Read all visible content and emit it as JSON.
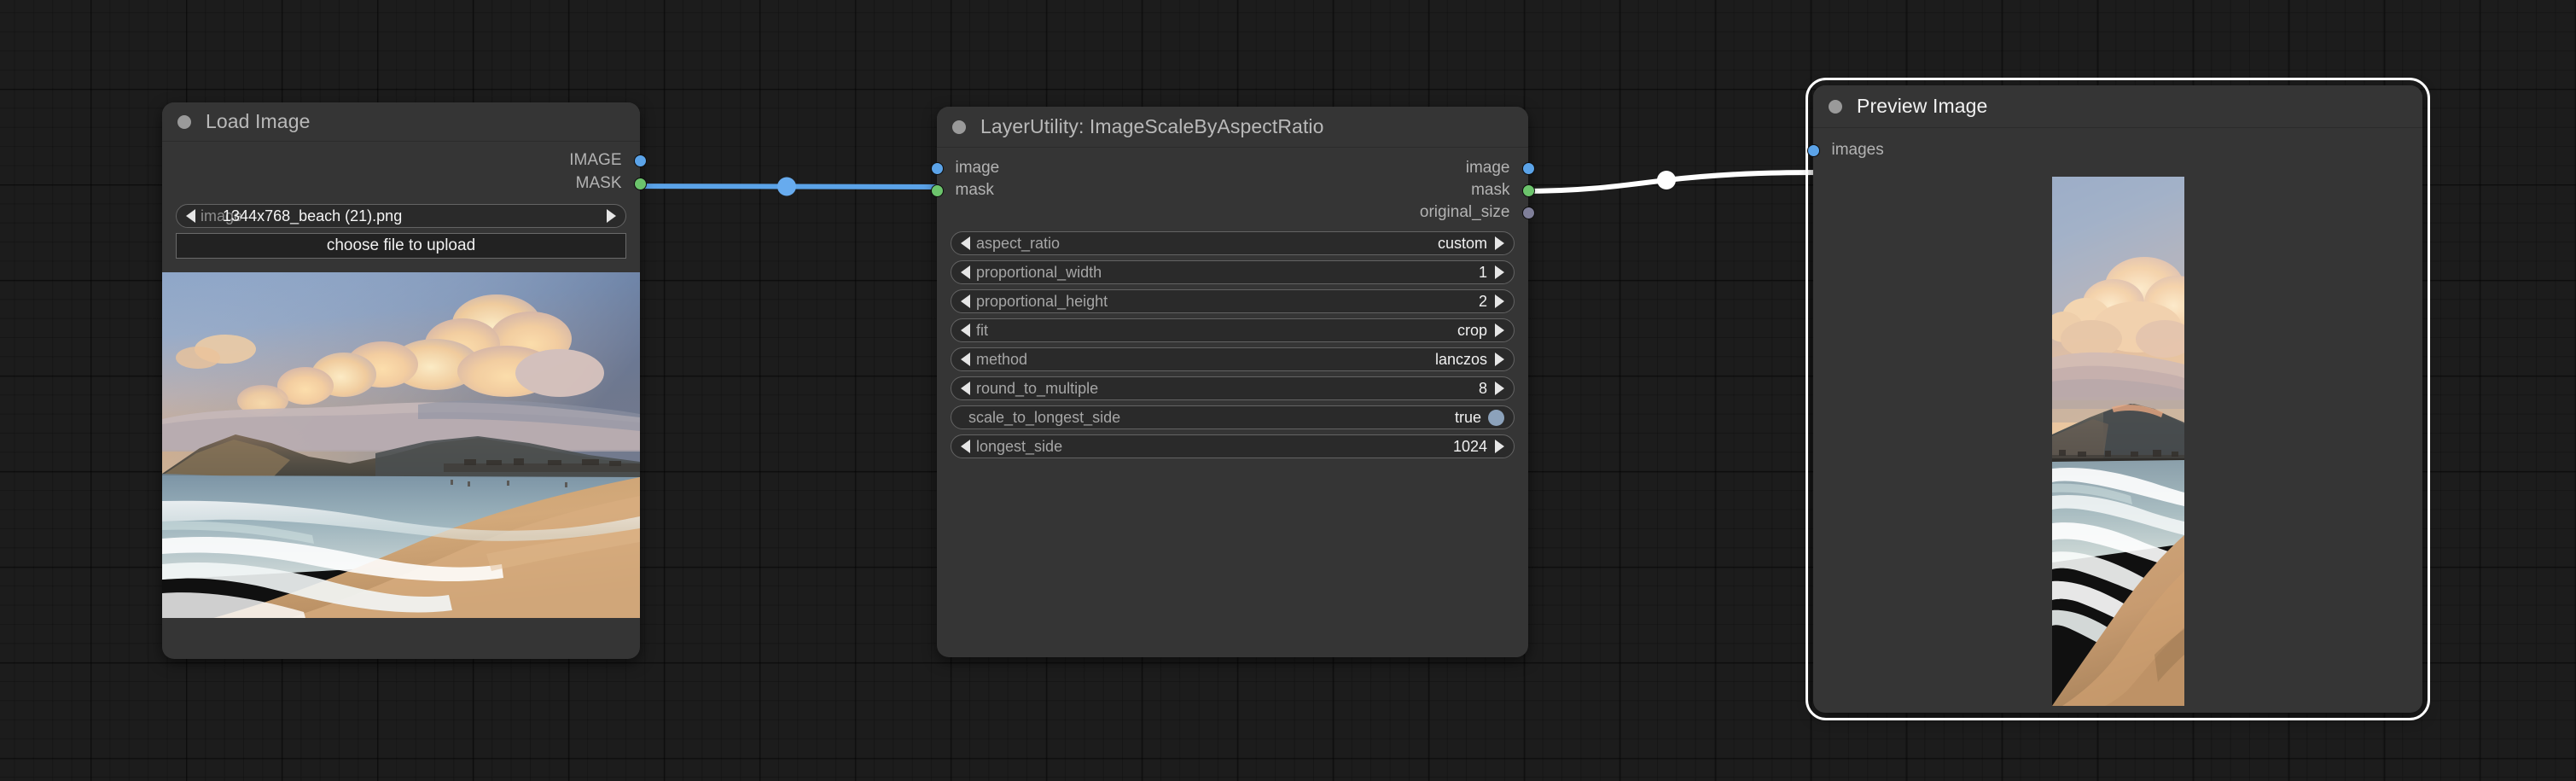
{
  "app": {
    "kind": "node-graph-editor",
    "background_color": "#1c1c1c",
    "grid_color": "#141414"
  },
  "colors": {
    "node_bg": "#353535",
    "node_title_bg": "#353535",
    "widget_bg": "#2a2a2a",
    "slot_image": "#5ba3e8",
    "slot_mask": "#6cc46c",
    "slot_generic": "#7f7f99",
    "link_image": "#5ba3e8",
    "link_selected": "#ffffff",
    "selection_ring": "#ffffff",
    "toggle_on": "#8ca2bb"
  },
  "nodes": [
    {
      "id": "load-image",
      "title": "Load Image",
      "selected": false,
      "outputs": [
        {
          "label": "IMAGE",
          "color": "#5ba3e8"
        },
        {
          "label": "MASK",
          "color": "#6cc46c"
        }
      ],
      "inputs": [],
      "widgets": [
        {
          "type": "combo-overlap",
          "label": "image",
          "value": "1344x768_beach (21).png"
        }
      ],
      "button": {
        "label": "choose file to upload"
      },
      "preview": {
        "alt": "beach-sunset-landscape-thumbnail"
      }
    },
    {
      "id": "image-scale-by-aspect-ratio",
      "title": "LayerUtility: ImageScaleByAspectRatio",
      "selected": false,
      "inputs": [
        {
          "label": "image",
          "color": "#5ba3e8"
        },
        {
          "label": "mask",
          "color": "#6cc46c"
        }
      ],
      "outputs": [
        {
          "label": "image",
          "color": "#5ba3e8"
        },
        {
          "label": "mask",
          "color": "#6cc46c"
        },
        {
          "label": "original_size",
          "color": "#7f7f99"
        }
      ],
      "widgets": [
        {
          "type": "combo",
          "label": "aspect_ratio",
          "value": "custom"
        },
        {
          "type": "number",
          "label": "proportional_width",
          "value": "1"
        },
        {
          "type": "number",
          "label": "proportional_height",
          "value": "2"
        },
        {
          "type": "combo",
          "label": "fit",
          "value": "crop"
        },
        {
          "type": "combo",
          "label": "method",
          "value": "lanczos"
        },
        {
          "type": "number",
          "label": "round_to_multiple",
          "value": "8"
        },
        {
          "type": "toggle",
          "label": "scale_to_longest_side",
          "value": "true"
        },
        {
          "type": "number",
          "label": "longest_side",
          "value": "1024"
        }
      ]
    },
    {
      "id": "preview-image",
      "title": "Preview Image",
      "selected": true,
      "inputs": [
        {
          "label": "images",
          "color": "#5ba3e8"
        }
      ],
      "outputs": [],
      "widgets": [],
      "preview": {
        "alt": "beach-sunset-portrait-crop-thumbnail"
      }
    }
  ],
  "links": [
    {
      "id": "link-image-to-scale",
      "from": "load-image.IMAGE",
      "to": "image-scale-by-aspect-ratio.image",
      "color": "#5ba3e8",
      "selected": false
    },
    {
      "id": "link-scale-to-preview",
      "from": "image-scale-by-aspect-ratio.image",
      "to": "preview-image.images",
      "color": "#ffffff",
      "selected": true
    }
  ]
}
